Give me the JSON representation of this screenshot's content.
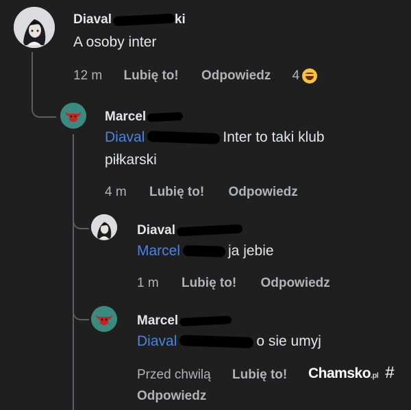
{
  "comments": [
    {
      "author": "Diaval",
      "author_suffix": "ki",
      "text": "A osoby inter",
      "time": "12 m",
      "like_label": "Lubię to!",
      "reply_label": "Odpowiedz",
      "reaction_count": "4",
      "reaction_icon": "laughing-emoji-icon"
    },
    {
      "author": "Marcel",
      "mention": "Diaval",
      "text_after_mention": "Inter to taki klub",
      "text_line2": "piłkarski",
      "time": "4 m",
      "like_label": "Lubię to!",
      "reply_label": "Odpowiedz"
    },
    {
      "author": "Diaval",
      "mention": "Marcel",
      "text_after_mention": "ja jebie",
      "time": "1 m",
      "like_label": "Lubię to!",
      "reply_label": "Odpowiedz"
    },
    {
      "author": "Marcel",
      "mention": "Diaval",
      "text_after_mention": "o sie umyj",
      "time": "Przed chwilą",
      "like_label": "Lubię to!",
      "reply_label": "Odpowiedz"
    }
  ],
  "watermark": {
    "brand": "Chamsko",
    "tld": ".pl",
    "symbol": "#"
  },
  "colors": {
    "background": "#1f1f1f",
    "mention": "#4b84e0",
    "meta": "#b0b3b8",
    "bull_avatar": "#3a8a80"
  }
}
